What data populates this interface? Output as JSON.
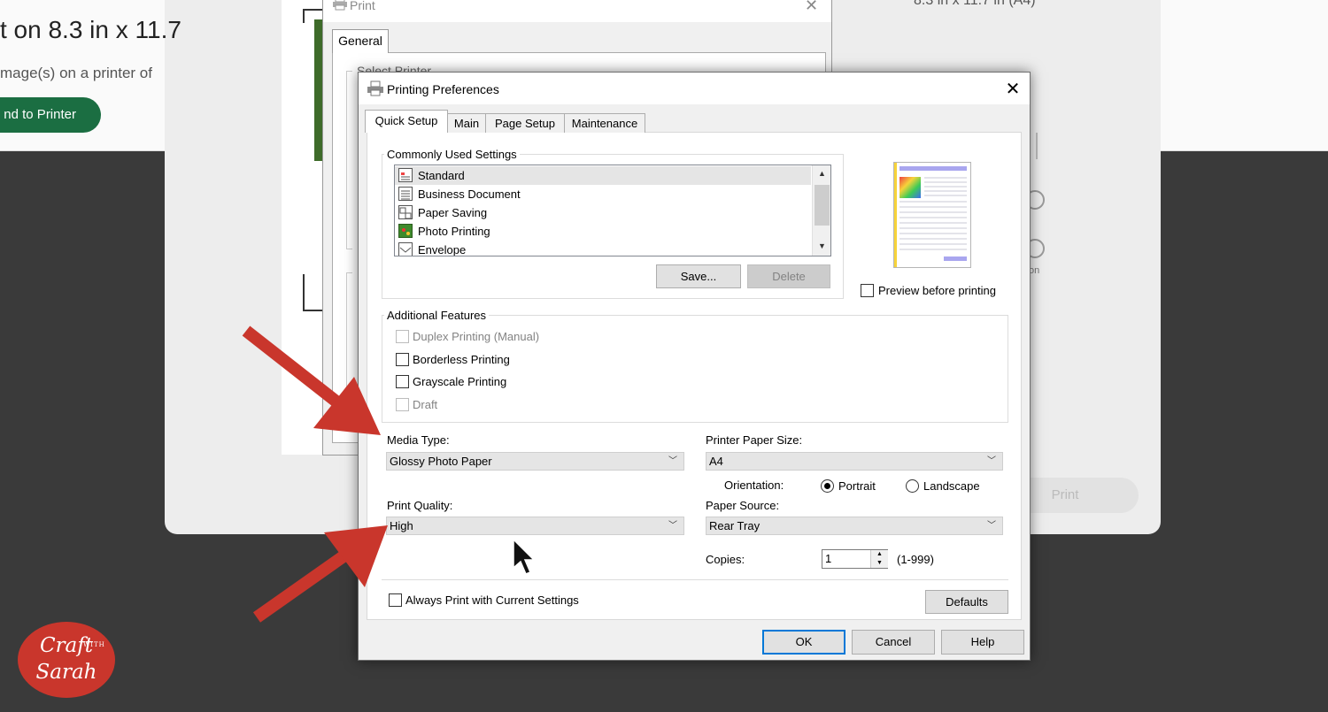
{
  "background": {
    "heading": "t on 8.3 in x 11.7",
    "subtext": "mage(s) on a printer of",
    "send_button": "nd to Printer",
    "size_label": "8.3 in x 11.7 in (A4)",
    "print_button": "Print",
    "radio_label": "on"
  },
  "print_dialog": {
    "title": "Print",
    "tab_general": "General",
    "group_select_printer": "Select Printer"
  },
  "prefs": {
    "title": "Printing Preferences",
    "tabs": [
      "Quick Setup",
      "Main",
      "Page Setup",
      "Maintenance"
    ],
    "commonly_used_label": "Commonly Used Settings",
    "list_items": [
      "Standard",
      "Business Document",
      "Paper Saving",
      "Photo Printing",
      "Envelope"
    ],
    "save_button": "Save...",
    "delete_button": "Delete",
    "preview_checkbox": "Preview before printing",
    "additional_label": "Additional Features",
    "features": [
      "Duplex Printing (Manual)",
      "Borderless Printing",
      "Grayscale Printing",
      "Draft"
    ],
    "media_type_label": "Media Type:",
    "media_type_value": "Glossy Photo Paper",
    "paper_size_label": "Printer Paper Size:",
    "paper_size_value": "A4",
    "orientation_label": "Orientation:",
    "portrait": "Portrait",
    "landscape": "Landscape",
    "print_quality_label": "Print Quality:",
    "print_quality_value": "High",
    "paper_source_label": "Paper Source:",
    "paper_source_value": "Rear Tray",
    "copies_label": "Copies:",
    "copies_value": "1",
    "copies_range": "(1-999)",
    "always_print_label": "Always Print with Current Settings",
    "defaults_button": "Defaults",
    "ok_button": "OK",
    "cancel_button": "Cancel",
    "help_button": "Help"
  },
  "logo": {
    "top": "Craft",
    "with": "WITH",
    "bottom": "Sarah"
  },
  "colors": {
    "arrow": "#c9362c",
    "brand_green": "#1b6e42",
    "focus_blue": "#0078d7"
  }
}
